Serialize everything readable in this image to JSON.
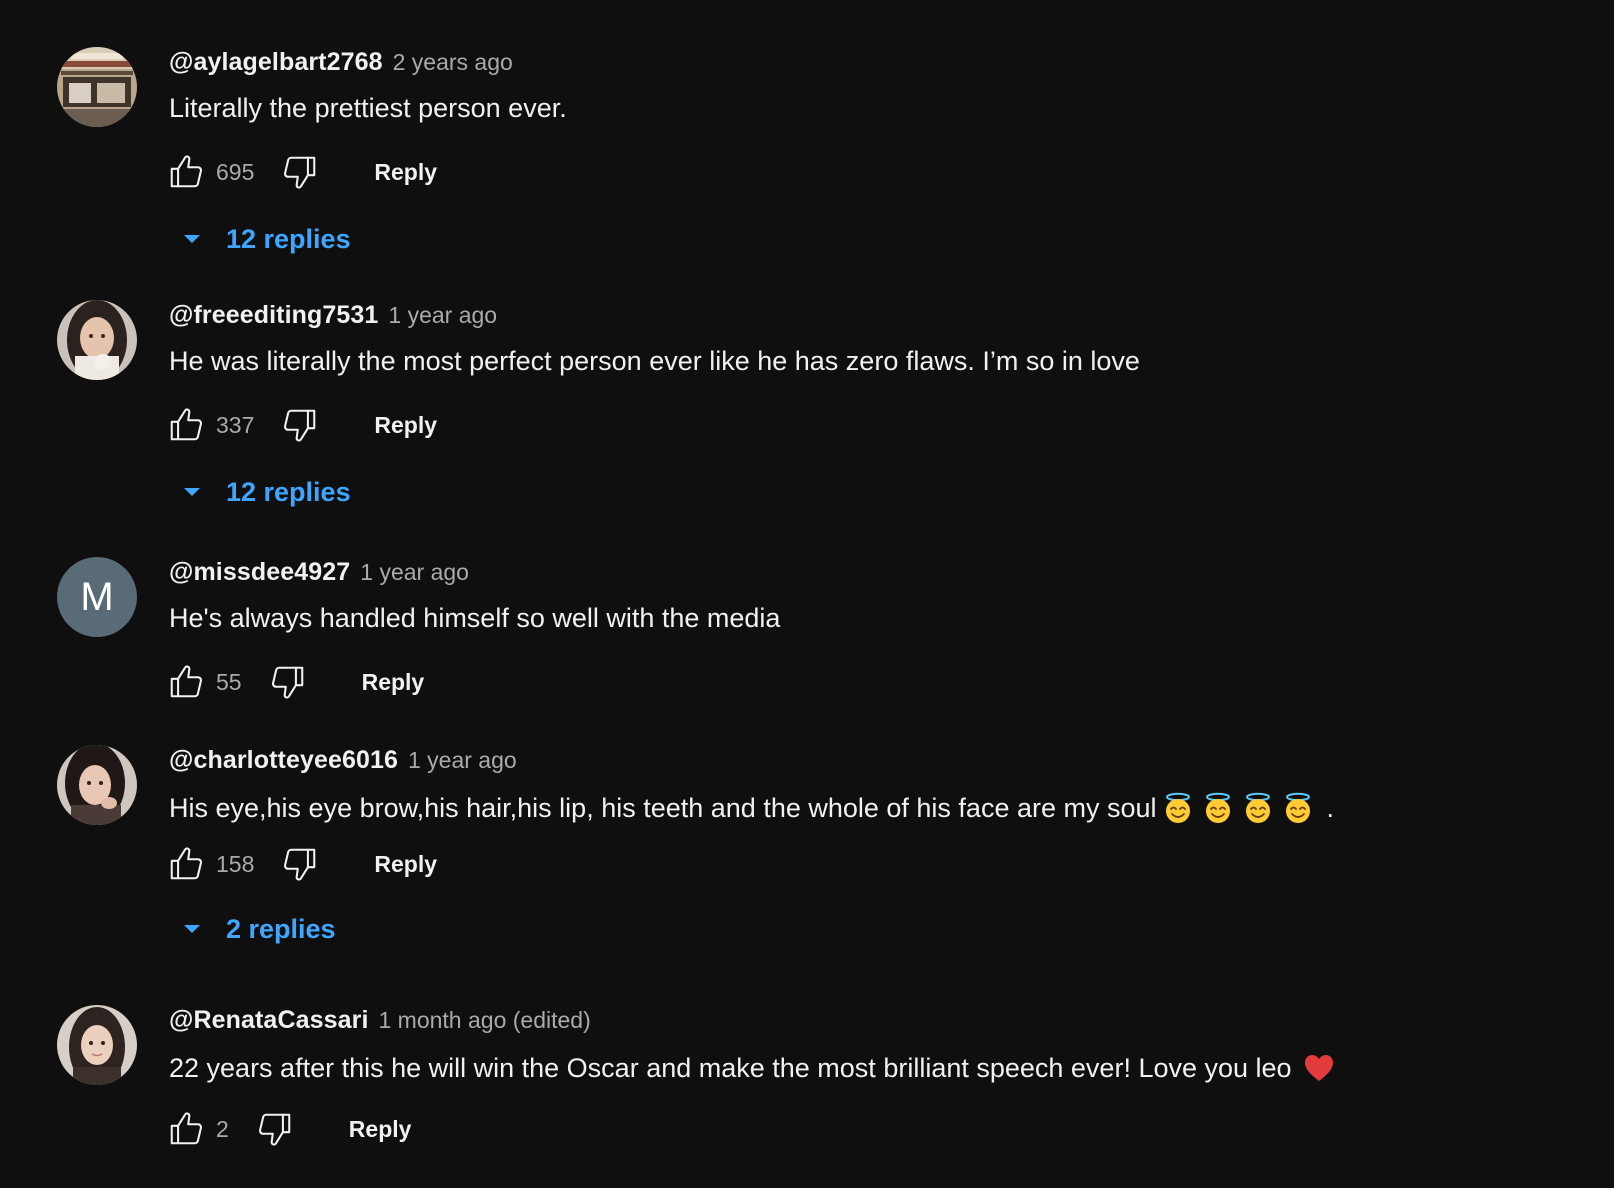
{
  "colors": {
    "background": "#0f0f0f",
    "text": "#f1f1f1",
    "muted": "#aaaaaa",
    "link": "#3ea6ff"
  },
  "comments": [
    {
      "handle": "@aylagelbart2768",
      "time": "2 years ago",
      "text": "Literally the prettiest person ever.",
      "likes": "695",
      "reply_label": "Reply",
      "replies_label": "12 replies",
      "avatar": "storefront-photo"
    },
    {
      "handle": "@freeediting7531",
      "time": "1 year ago",
      "text": "He was literally the most perfect person ever like he has zero flaws. I’m so in love",
      "likes": "337",
      "reply_label": "Reply",
      "replies_label": "12 replies",
      "avatar": "person-photo"
    },
    {
      "handle": "@missdee4927",
      "time": "1 year ago",
      "text": "He's always handled himself so well with the media",
      "likes": "55",
      "reply_label": "Reply",
      "avatar_letter": "M",
      "avatar_color": "#5a6b78"
    },
    {
      "handle": "@charlotteyee6016",
      "time": "1 year ago",
      "text": "His eye,his eye brow,his hair,his lip, his teeth and the whole of his face are my soul",
      "text_suffix": ".",
      "emoji": [
        "smiling-face-with-halo",
        "smiling-face-with-halo",
        "smiling-face-with-halo",
        "smiling-face-with-halo"
      ],
      "likes": "158",
      "reply_label": "Reply",
      "replies_label": "2 replies",
      "avatar": "person-photo"
    },
    {
      "handle": "@RenataCassari",
      "time": "1 month ago (edited)",
      "text": "22 years after this he will win the Oscar and make the most brilliant speech ever! Love you leo",
      "emoji": [
        "red-heart"
      ],
      "likes": "2",
      "reply_label": "Reply",
      "avatar": "person-photo"
    }
  ]
}
